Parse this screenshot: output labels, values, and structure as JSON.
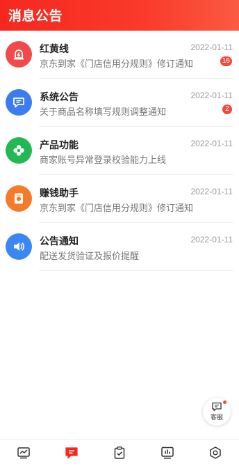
{
  "header": {
    "title": "消息公告"
  },
  "colors": {
    "accent": "#f5281f",
    "badge": "#f04a3e",
    "icon_red": "#f24a4a",
    "icon_blue": "#3d7cf0",
    "icon_green": "#22b853",
    "icon_orange": "#f57a2a",
    "icon_blue2": "#3a86f2"
  },
  "messages": [
    {
      "title": "红黄线",
      "date": "2022-01-11",
      "desc": "京东到家《门店信用分规则》修订通知",
      "badge": "16",
      "icon": "alarm-icon"
    },
    {
      "title": "系统公告",
      "date": "2022-01-11",
      "desc": "关于商品名称填写规则调整通知",
      "badge": "2",
      "icon": "message-icon"
    },
    {
      "title": "产品功能",
      "date": "2022-01-11",
      "desc": "商家账号异常登录校验能力上线",
      "badge": "",
      "icon": "gear-icon"
    },
    {
      "title": "赚钱助手",
      "date": "2022-01-11",
      "desc": "京东到家《门店信用分规则》修订通知",
      "badge": "",
      "icon": "wallet-icon"
    },
    {
      "title": "公告通知",
      "date": "2022-01-11",
      "desc": "配送发货验证及报价提醒",
      "badge": "",
      "icon": "speaker-icon"
    }
  ],
  "service": {
    "label": "客服"
  },
  "tabs": [
    {
      "icon": "chart-icon",
      "active": false
    },
    {
      "icon": "message-icon",
      "active": true
    },
    {
      "icon": "clipboard-icon",
      "active": false
    },
    {
      "icon": "stats-icon",
      "active": false
    },
    {
      "icon": "settings-icon",
      "active": false
    }
  ]
}
